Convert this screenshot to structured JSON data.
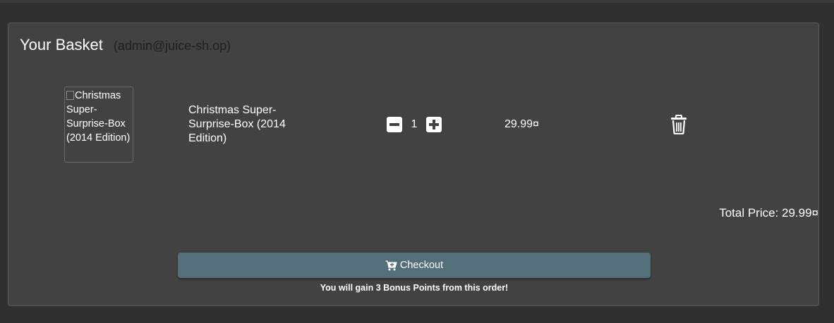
{
  "basket": {
    "title": "Your Basket",
    "user": "(admin@juice-sh.op)"
  },
  "items": [
    {
      "image_alt": "Christmas Super-Surprise-Box (2014 Edition)",
      "name": "Christmas Super-Surprise-Box (2014 Edition)",
      "quantity": "1",
      "price": "29.99¤"
    }
  ],
  "summary": {
    "total_price": "Total Price: 29.99¤"
  },
  "checkout": {
    "label": "Checkout",
    "bonus": "You will gain 3 Bonus Points from this order!"
  },
  "icons": {
    "decrease": "minus-square-icon",
    "increase": "plus-square-icon",
    "delete": "trash-icon",
    "cart": "cart-plus-icon",
    "broken_image": "broken-image-icon"
  },
  "colors": {
    "page_background": "#303030",
    "card_background": "#424242",
    "checkout_button": "#546e7a",
    "text": "#ffffff",
    "user_email": "#1f1f1f"
  }
}
